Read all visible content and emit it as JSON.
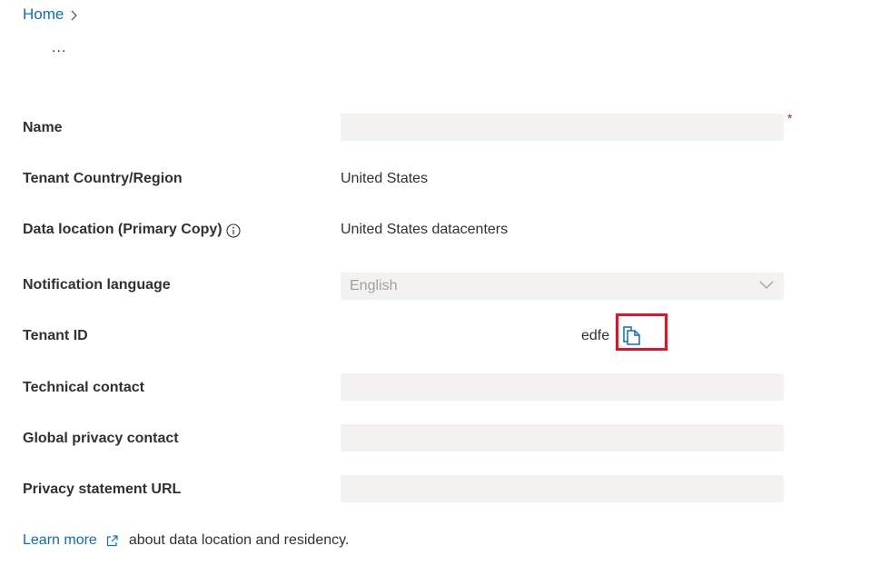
{
  "breadcrumb": {
    "home_label": "Home"
  },
  "header": {
    "ellipsis": "..."
  },
  "form": {
    "name": {
      "label": "Name",
      "value": "",
      "required_marker": "*"
    },
    "country": {
      "label": "Tenant Country/Region",
      "value": "United States"
    },
    "data_location": {
      "label": "Data location (Primary Copy)",
      "value": "United States datacenters"
    },
    "notification_language": {
      "label": "Notification language",
      "selected": "English"
    },
    "tenant_id": {
      "label": "Tenant ID",
      "value": "edfe"
    },
    "technical_contact": {
      "label": "Technical contact",
      "value": ""
    },
    "global_privacy_contact": {
      "label": "Global privacy contact",
      "value": ""
    },
    "privacy_statement_url": {
      "label": "Privacy statement URL",
      "value": ""
    }
  },
  "footer": {
    "learn_more_link": "Learn more",
    "learn_more_text": "about data location and residency."
  },
  "colors": {
    "link": "#0f6cbd",
    "field_bg": "#f3f2f1",
    "highlight_border": "#e81123",
    "required": "#a4262c"
  },
  "icons": [
    "chevron-right-icon",
    "info-icon",
    "chevron-down-icon",
    "copy-icon",
    "external-link-icon"
  ]
}
